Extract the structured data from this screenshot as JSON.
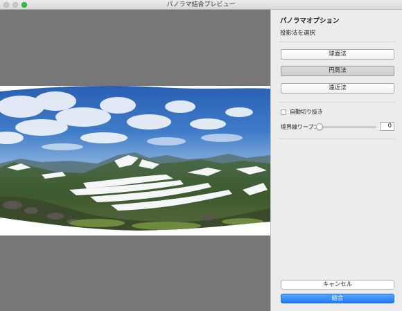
{
  "window": {
    "title": "パノラマ結合プレビュー"
  },
  "panel": {
    "title": "パノラマオプション",
    "projection_label": "投影法を選択",
    "projections": [
      {
        "label": "球面法",
        "selected": false
      },
      {
        "label": "円筒法",
        "selected": true
      },
      {
        "label": "遠近法",
        "selected": false
      }
    ],
    "auto_crop": {
      "label": "自動切り抜き",
      "checked": false
    },
    "boundary_warp": {
      "label": "境界線ワープ：",
      "value": "0",
      "slider_fraction": 0
    }
  },
  "buttons": {
    "cancel": "キャンセル",
    "merge": "結合"
  },
  "colors": {
    "accent": "#1f7bf2",
    "preview_bg": "#777777",
    "panel_bg": "#ececec"
  }
}
